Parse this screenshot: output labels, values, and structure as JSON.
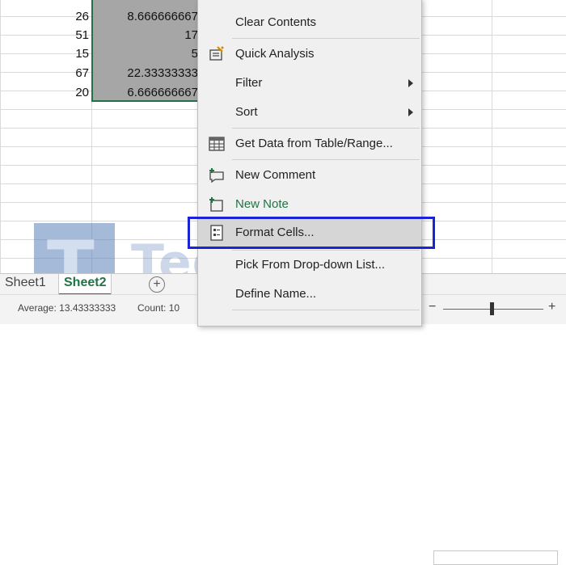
{
  "sheet": {
    "rows": [
      {
        "a": "",
        "b": ""
      },
      {
        "a": "26",
        "b": "8.666666667"
      },
      {
        "a": "51",
        "b": "17"
      },
      {
        "a": "15",
        "b": "5"
      },
      {
        "a": "67",
        "b": "22.33333333"
      },
      {
        "a": "20",
        "b": "6.666666667"
      }
    ]
  },
  "menu": {
    "items": [
      {
        "id": "clear-contents",
        "label": "Clear Contents",
        "icon": "",
        "submenu": false
      },
      {
        "id": "quick-analysis",
        "label": "Quick Analysis",
        "icon": "quick-analysis-icon",
        "submenu": false
      },
      {
        "id": "filter",
        "label": "Filter",
        "icon": "",
        "submenu": true
      },
      {
        "id": "sort",
        "label": "Sort",
        "icon": "",
        "submenu": true
      },
      {
        "id": "get-data",
        "label": "Get Data from Table/Range...",
        "icon": "table-icon",
        "submenu": false
      },
      {
        "id": "new-comment",
        "label": "New Comment",
        "icon": "comment-icon",
        "submenu": false
      },
      {
        "id": "new-note",
        "label": "New Note",
        "icon": "note-icon",
        "submenu": false
      },
      {
        "id": "format-cells",
        "label": "Format Cells...",
        "icon": "format-cells-icon",
        "submenu": false
      },
      {
        "id": "pick-from-list",
        "label": "Pick From Drop-down List...",
        "icon": "",
        "submenu": false
      },
      {
        "id": "define-name",
        "label": "Define Name...",
        "icon": "",
        "submenu": false
      }
    ]
  },
  "tabs": {
    "sheet1": "Sheet1",
    "sheet2": "Sheet2",
    "add": "+"
  },
  "status": {
    "average": "Average: 13.43333333",
    "count": "Count: 10",
    "zoom_minus": "−",
    "zoom_plus": "+"
  },
  "watermark": {
    "letter": "T",
    "text": "TediEka"
  },
  "colors": {
    "excel_green": "#217346",
    "highlight_blue": "#1a24d6"
  }
}
